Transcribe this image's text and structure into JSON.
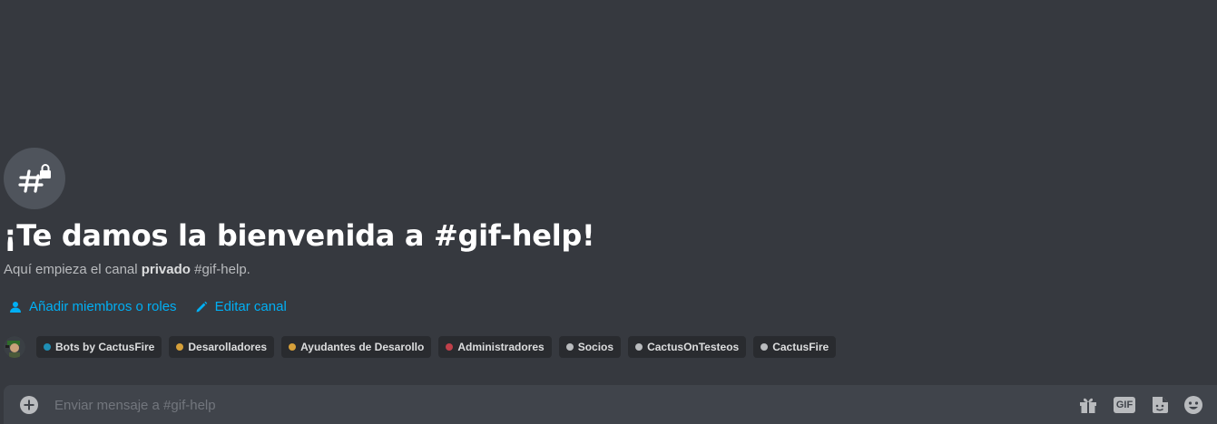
{
  "channel": {
    "icon": "hashtag-lock-icon",
    "welcome_title": "¡Te damos la bienvenida a #gif-help!",
    "subtitle_prefix": "Aquí empieza el canal ",
    "subtitle_bold": "privado",
    "subtitle_suffix": " #gif-help."
  },
  "actions": {
    "add_members": "Añadir miembros o roles",
    "edit_channel": "Editar canal"
  },
  "roles": [
    {
      "name": "Bots by CactusFire",
      "color": "#1f8fb5"
    },
    {
      "name": "Desarolladores",
      "color": "#d6a03a"
    },
    {
      "name": "Ayudantes de Desarollo",
      "color": "#d6a03a"
    },
    {
      "name": "Administradores",
      "color": "#c0404a"
    },
    {
      "name": "Socios",
      "color": "#b9bbbe"
    },
    {
      "name": "CactusOnTesteos",
      "color": "#b9bbbe"
    },
    {
      "name": "CactusFire",
      "color": "#b9bbbe"
    }
  ],
  "composer": {
    "placeholder": "Enviar mensaje a #gif-help",
    "gif_label": "GIF"
  },
  "colors": {
    "background": "#36393f",
    "link": "#00aff4",
    "composer": "#40444b"
  }
}
